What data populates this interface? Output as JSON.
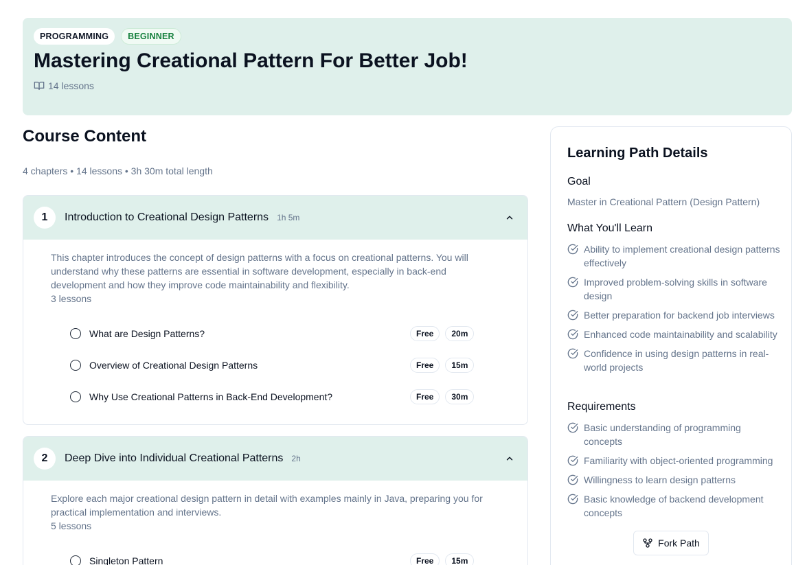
{
  "hero": {
    "badges": {
      "category": "PROGRAMMING",
      "level": "BEGINNER"
    },
    "title": "Mastering Creational Pattern For Better Job!",
    "lessons": "14 lessons",
    "icon": "book-open-icon"
  },
  "content": {
    "title": "Course Content",
    "summary": "4 chapters • 14 lessons • 3h 30m total length"
  },
  "chapters": [
    {
      "number": "1",
      "title": "Introduction to Creational Design Patterns",
      "duration": "1h 5m",
      "expanded": true,
      "description": "This chapter introduces the concept of design patterns with a focus on creational patterns. You will understand why these patterns are essential in software development, especially in back-end development and how they improve code maintainability and flexibility.",
      "lesson_count": "3 lessons",
      "lessons": [
        {
          "title": "What are Design Patterns?",
          "access": "Free",
          "duration": "20m"
        },
        {
          "title": "Overview of Creational Design Patterns",
          "access": "Free",
          "duration": "15m"
        },
        {
          "title": "Why Use Creational Patterns in Back-End Development?",
          "access": "Free",
          "duration": "30m"
        }
      ]
    },
    {
      "number": "2",
      "title": "Deep Dive into Individual Creational Patterns",
      "duration": "2h",
      "expanded": true,
      "description": "Explore each major creational design pattern in detail with examples mainly in Java, preparing you for practical implementation and interviews.",
      "lesson_count": "5 lessons",
      "lessons": [
        {
          "title": "Singleton Pattern",
          "access": "Free",
          "duration": "15m"
        }
      ]
    }
  ],
  "sidebar": {
    "title": "Learning Path Details",
    "goal_heading": "Goal",
    "goal": "Master in Creational Pattern (Design Pattern)",
    "learn_heading": "What You'll Learn",
    "learn": [
      "Ability to implement creational design patterns effectively",
      "Improved problem-solving skills in software design",
      "Better preparation for backend job interviews",
      "Enhanced code maintainability and scalability",
      "Confidence in using design patterns in real-world projects"
    ],
    "req_heading": "Requirements",
    "requirements": [
      "Basic understanding of programming concepts",
      "Familiarity with object-oriented programming",
      "Willingness to learn design patterns",
      "Basic knowledge of backend development concepts"
    ],
    "fork_label": "Fork Path"
  },
  "colors": {
    "hero_bg": "#dff0eb",
    "level_green": "#15803d",
    "muted": "#64748b",
    "border": "#e2e8f0"
  }
}
